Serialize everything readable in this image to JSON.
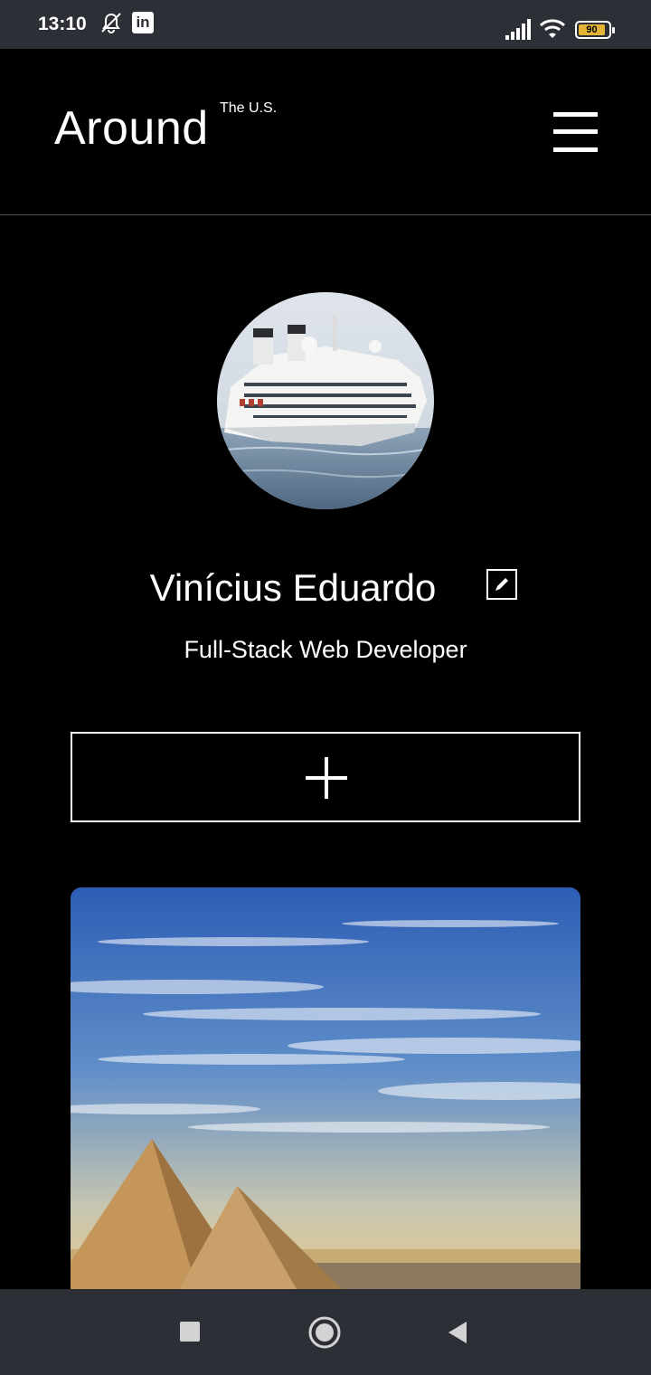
{
  "status_bar": {
    "time": "13:10",
    "linkedin_label": "in",
    "battery_level": "90",
    "battery_fraction": 0.9,
    "icons": [
      "mute-icon",
      "linkedin-icon",
      "signal-icon",
      "wifi-icon",
      "battery-icon"
    ]
  },
  "header": {
    "logo": "Around",
    "logo_sup": "The U.S.",
    "menu_icon": "hamburger-menu-icon"
  },
  "profile": {
    "name": "Vinícius Eduardo",
    "job": "Full-Stack Web Developer",
    "edit_icon": "pencil-icon",
    "avatar": "cruise-ship-photo"
  },
  "add_button": {
    "icon": "plus-icon"
  },
  "cards": [
    {
      "image": "pyramids-photo"
    }
  ],
  "nav_bar": {
    "icons": [
      "recents-square-icon",
      "home-circle-icon",
      "back-triangle-icon"
    ]
  },
  "colors": {
    "background": "#000000",
    "system_bars": "#2d2f36",
    "battery_fill": "#e3b436",
    "text": "#ffffff"
  }
}
